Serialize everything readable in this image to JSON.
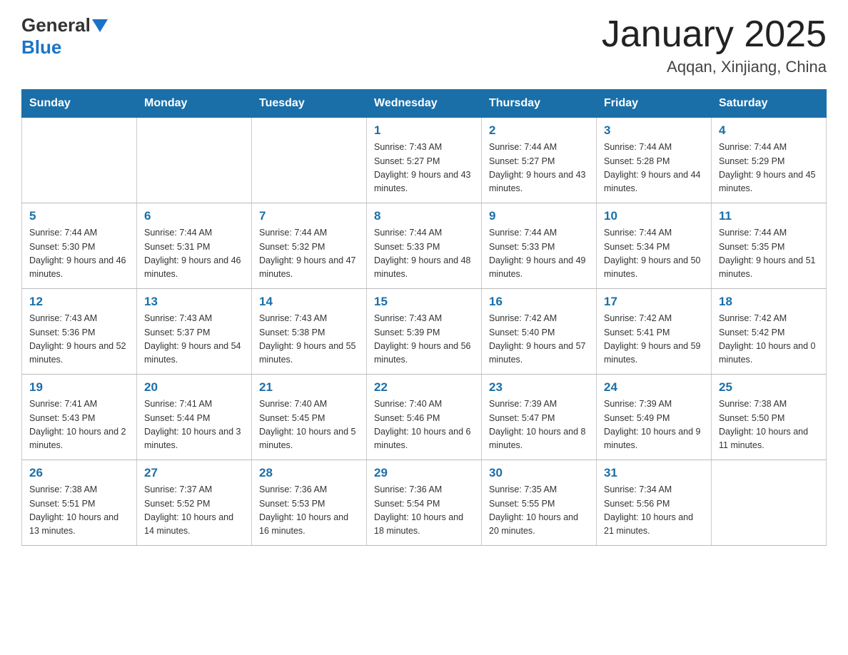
{
  "header": {
    "logo_general": "General",
    "logo_blue": "Blue",
    "title": "January 2025",
    "subtitle": "Aqqan, Xinjiang, China"
  },
  "weekdays": [
    "Sunday",
    "Monday",
    "Tuesday",
    "Wednesday",
    "Thursday",
    "Friday",
    "Saturday"
  ],
  "weeks": [
    [
      {
        "day": "",
        "info": ""
      },
      {
        "day": "",
        "info": ""
      },
      {
        "day": "",
        "info": ""
      },
      {
        "day": "1",
        "info": "Sunrise: 7:43 AM\nSunset: 5:27 PM\nDaylight: 9 hours\nand 43 minutes."
      },
      {
        "day": "2",
        "info": "Sunrise: 7:44 AM\nSunset: 5:27 PM\nDaylight: 9 hours\nand 43 minutes."
      },
      {
        "day": "3",
        "info": "Sunrise: 7:44 AM\nSunset: 5:28 PM\nDaylight: 9 hours\nand 44 minutes."
      },
      {
        "day": "4",
        "info": "Sunrise: 7:44 AM\nSunset: 5:29 PM\nDaylight: 9 hours\nand 45 minutes."
      }
    ],
    [
      {
        "day": "5",
        "info": "Sunrise: 7:44 AM\nSunset: 5:30 PM\nDaylight: 9 hours\nand 46 minutes."
      },
      {
        "day": "6",
        "info": "Sunrise: 7:44 AM\nSunset: 5:31 PM\nDaylight: 9 hours\nand 46 minutes."
      },
      {
        "day": "7",
        "info": "Sunrise: 7:44 AM\nSunset: 5:32 PM\nDaylight: 9 hours\nand 47 minutes."
      },
      {
        "day": "8",
        "info": "Sunrise: 7:44 AM\nSunset: 5:33 PM\nDaylight: 9 hours\nand 48 minutes."
      },
      {
        "day": "9",
        "info": "Sunrise: 7:44 AM\nSunset: 5:33 PM\nDaylight: 9 hours\nand 49 minutes."
      },
      {
        "day": "10",
        "info": "Sunrise: 7:44 AM\nSunset: 5:34 PM\nDaylight: 9 hours\nand 50 minutes."
      },
      {
        "day": "11",
        "info": "Sunrise: 7:44 AM\nSunset: 5:35 PM\nDaylight: 9 hours\nand 51 minutes."
      }
    ],
    [
      {
        "day": "12",
        "info": "Sunrise: 7:43 AM\nSunset: 5:36 PM\nDaylight: 9 hours\nand 52 minutes."
      },
      {
        "day": "13",
        "info": "Sunrise: 7:43 AM\nSunset: 5:37 PM\nDaylight: 9 hours\nand 54 minutes."
      },
      {
        "day": "14",
        "info": "Sunrise: 7:43 AM\nSunset: 5:38 PM\nDaylight: 9 hours\nand 55 minutes."
      },
      {
        "day": "15",
        "info": "Sunrise: 7:43 AM\nSunset: 5:39 PM\nDaylight: 9 hours\nand 56 minutes."
      },
      {
        "day": "16",
        "info": "Sunrise: 7:42 AM\nSunset: 5:40 PM\nDaylight: 9 hours\nand 57 minutes."
      },
      {
        "day": "17",
        "info": "Sunrise: 7:42 AM\nSunset: 5:41 PM\nDaylight: 9 hours\nand 59 minutes."
      },
      {
        "day": "18",
        "info": "Sunrise: 7:42 AM\nSunset: 5:42 PM\nDaylight: 10 hours\nand 0 minutes."
      }
    ],
    [
      {
        "day": "19",
        "info": "Sunrise: 7:41 AM\nSunset: 5:43 PM\nDaylight: 10 hours\nand 2 minutes."
      },
      {
        "day": "20",
        "info": "Sunrise: 7:41 AM\nSunset: 5:44 PM\nDaylight: 10 hours\nand 3 minutes."
      },
      {
        "day": "21",
        "info": "Sunrise: 7:40 AM\nSunset: 5:45 PM\nDaylight: 10 hours\nand 5 minutes."
      },
      {
        "day": "22",
        "info": "Sunrise: 7:40 AM\nSunset: 5:46 PM\nDaylight: 10 hours\nand 6 minutes."
      },
      {
        "day": "23",
        "info": "Sunrise: 7:39 AM\nSunset: 5:47 PM\nDaylight: 10 hours\nand 8 minutes."
      },
      {
        "day": "24",
        "info": "Sunrise: 7:39 AM\nSunset: 5:49 PM\nDaylight: 10 hours\nand 9 minutes."
      },
      {
        "day": "25",
        "info": "Sunrise: 7:38 AM\nSunset: 5:50 PM\nDaylight: 10 hours\nand 11 minutes."
      }
    ],
    [
      {
        "day": "26",
        "info": "Sunrise: 7:38 AM\nSunset: 5:51 PM\nDaylight: 10 hours\nand 13 minutes."
      },
      {
        "day": "27",
        "info": "Sunrise: 7:37 AM\nSunset: 5:52 PM\nDaylight: 10 hours\nand 14 minutes."
      },
      {
        "day": "28",
        "info": "Sunrise: 7:36 AM\nSunset: 5:53 PM\nDaylight: 10 hours\nand 16 minutes."
      },
      {
        "day": "29",
        "info": "Sunrise: 7:36 AM\nSunset: 5:54 PM\nDaylight: 10 hours\nand 18 minutes."
      },
      {
        "day": "30",
        "info": "Sunrise: 7:35 AM\nSunset: 5:55 PM\nDaylight: 10 hours\nand 20 minutes."
      },
      {
        "day": "31",
        "info": "Sunrise: 7:34 AM\nSunset: 5:56 PM\nDaylight: 10 hours\nand 21 minutes."
      },
      {
        "day": "",
        "info": ""
      }
    ]
  ]
}
